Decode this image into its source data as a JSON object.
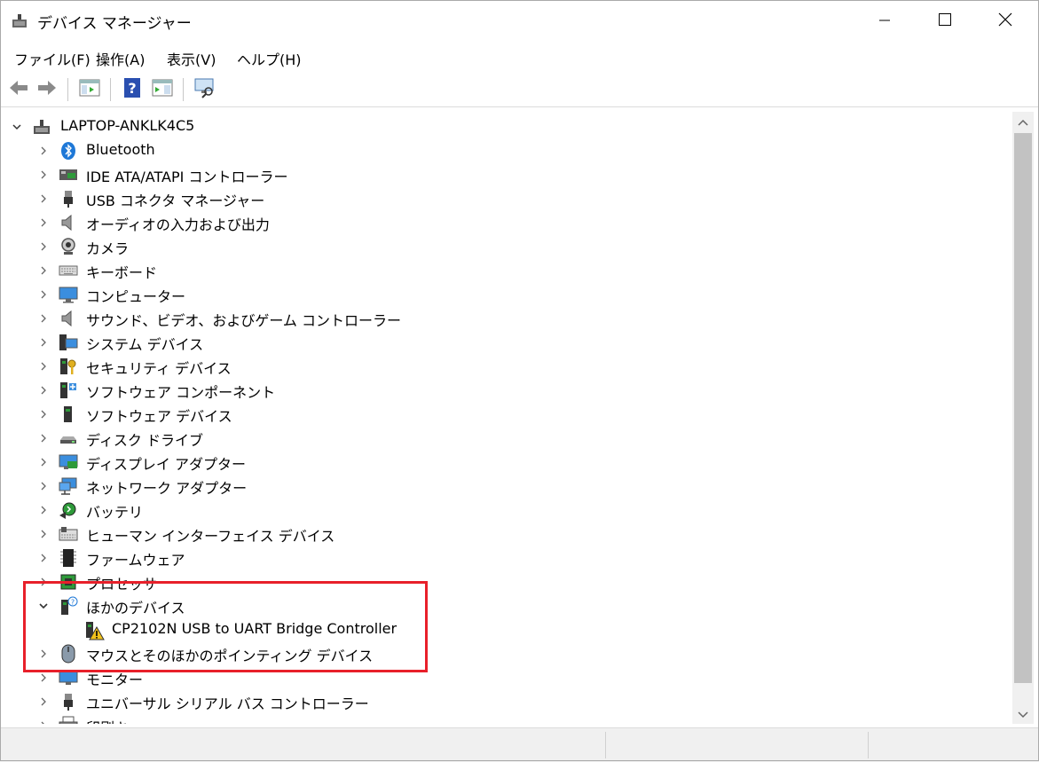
{
  "window": {
    "title": "デバイス マネージャー",
    "icon": "device-manager-icon",
    "controls": [
      "minimize-icon",
      "maximize-icon",
      "close-icon"
    ]
  },
  "menu": {
    "items": [
      "ファイル(F)",
      "操作(A)",
      "表示(V)",
      "ヘルプ(H)"
    ]
  },
  "toolbar": {
    "buttons": [
      "back-arrow-icon",
      "forward-arrow-icon",
      "show-hide-console-tree-icon",
      "help-icon",
      "properties-icon",
      "scan-hardware-icon"
    ]
  },
  "tree": {
    "root": "LAPTOP-ANKLK4C5",
    "categories": [
      {
        "label": "Bluetooth",
        "icon": "bluetooth-icon",
        "expanded": false
      },
      {
        "label": "IDE ATA/ATAPI コントローラー",
        "icon": "ide-controller-icon",
        "expanded": false
      },
      {
        "label": "USB コネクタ マネージャー",
        "icon": "usb-connector-icon",
        "expanded": false
      },
      {
        "label": "オーディオの入力および出力",
        "icon": "speaker-icon",
        "expanded": false
      },
      {
        "label": "カメラ",
        "icon": "camera-icon",
        "expanded": false
      },
      {
        "label": "キーボード",
        "icon": "keyboard-icon",
        "expanded": false
      },
      {
        "label": "コンピューター",
        "icon": "monitor-icon",
        "expanded": false
      },
      {
        "label": "サウンド、ビデオ、およびゲーム コントローラー",
        "icon": "speaker-icon",
        "expanded": false
      },
      {
        "label": "システム デバイス",
        "icon": "system-device-icon",
        "expanded": false
      },
      {
        "label": "セキュリティ デバイス",
        "icon": "security-key-icon",
        "expanded": false
      },
      {
        "label": "ソフトウェア コンポーネント",
        "icon": "software-component-icon",
        "expanded": false
      },
      {
        "label": "ソフトウェア デバイス",
        "icon": "software-device-icon",
        "expanded": false
      },
      {
        "label": "ディスク ドライブ",
        "icon": "disk-drive-icon",
        "expanded": false
      },
      {
        "label": "ディスプレイ アダプター",
        "icon": "display-adapter-icon",
        "expanded": false
      },
      {
        "label": "ネットワーク アダプター",
        "icon": "network-adapter-icon",
        "expanded": false
      },
      {
        "label": "バッテリ",
        "icon": "battery-icon",
        "expanded": false
      },
      {
        "label": "ヒューマン インターフェイス デバイス",
        "icon": "hid-icon",
        "expanded": false
      },
      {
        "label": "ファームウェア",
        "icon": "firmware-chip-icon",
        "expanded": false
      },
      {
        "label": "プロセッサ",
        "icon": "processor-icon",
        "expanded": false
      },
      {
        "label": "ほかのデバイス",
        "icon": "unknown-device-icon",
        "expanded": true
      },
      {
        "label": "CP2102N USB to UART Bridge Controller",
        "icon": "warning-device-icon",
        "child": true
      },
      {
        "label": "マウスとそのほかのポインティング デバイス",
        "icon": "mouse-icon",
        "expanded": false
      },
      {
        "label": "モニター",
        "icon": "monitor-icon",
        "expanded": false
      },
      {
        "label": "ユニバーサル シリアル バス コントローラー",
        "icon": "usb-connector-icon",
        "expanded": false
      },
      {
        "label": "印刷キュー",
        "icon": "printer-icon",
        "expanded": false
      }
    ]
  },
  "colors": {
    "highlight": "#e8202a",
    "accent": "#1e78d7"
  }
}
